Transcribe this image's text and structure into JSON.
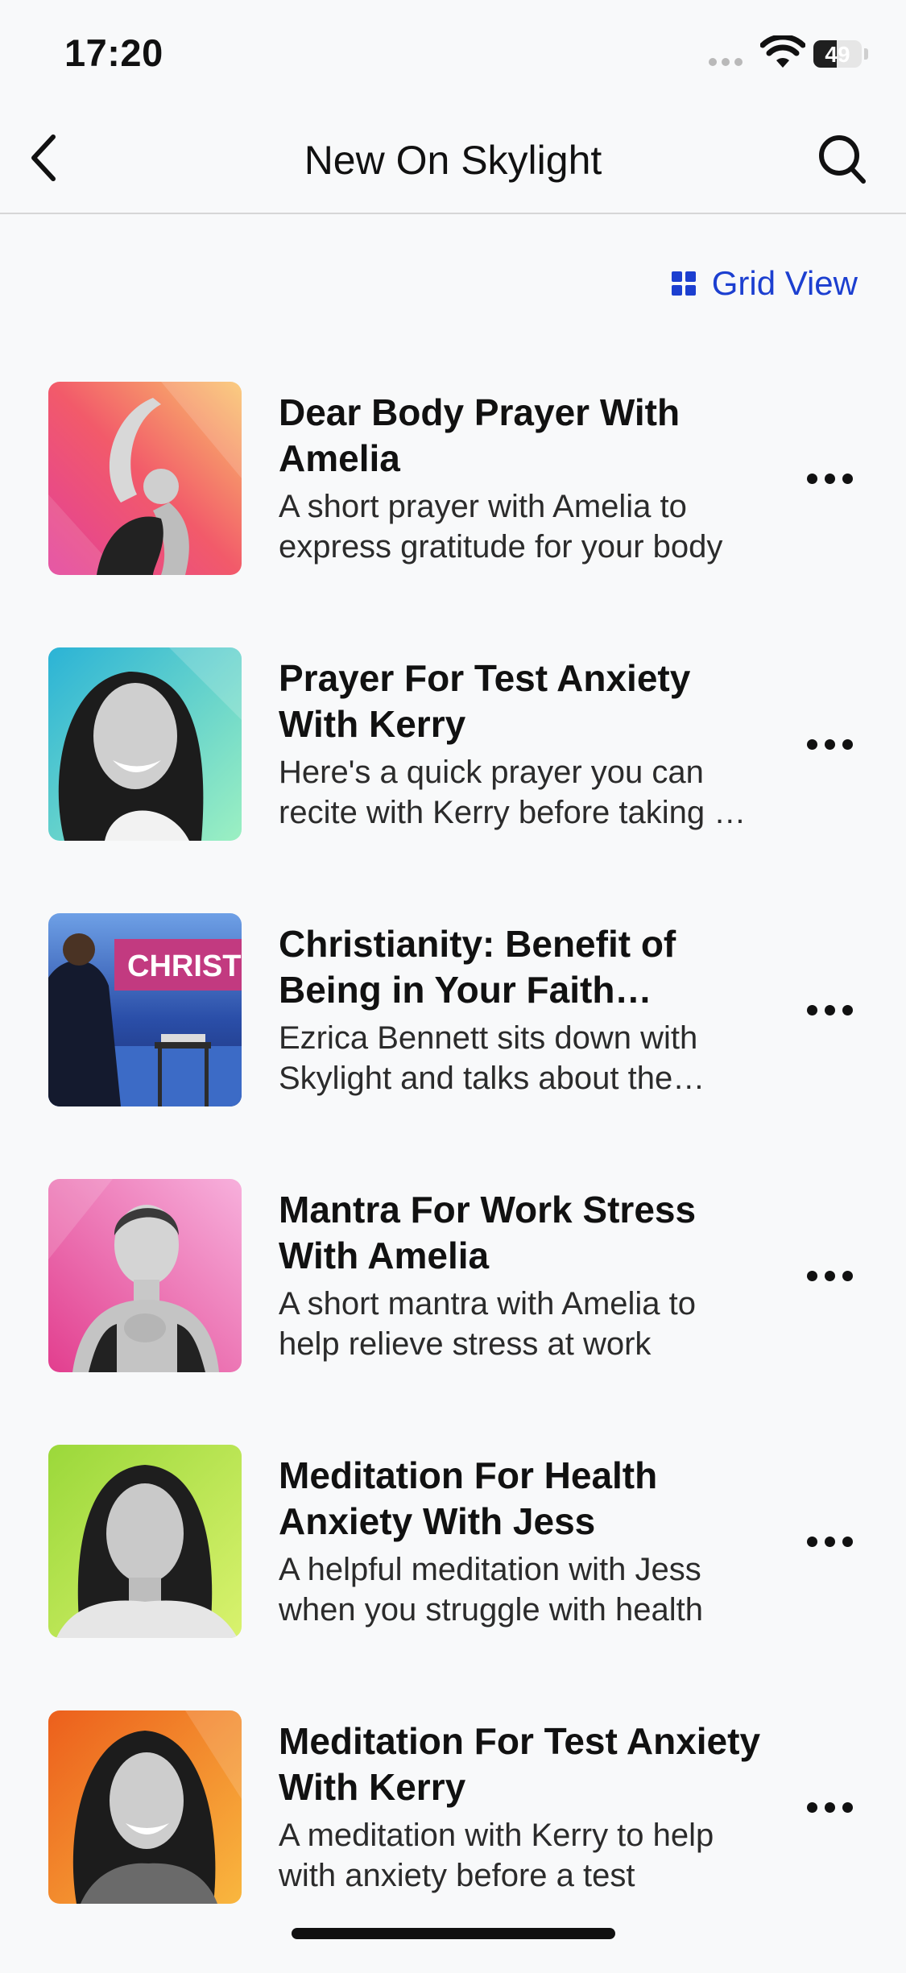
{
  "status_bar": {
    "time": "17:20",
    "battery": "49",
    "battery_level": 0.49
  },
  "navbar": {
    "title": "New On Skylight",
    "back_icon": "chevron-left-icon",
    "search_icon": "search-icon"
  },
  "view_toggle": {
    "label": "Grid View",
    "icon": "grid-icon",
    "color": "#1c3fd0"
  },
  "items": [
    {
      "title": "Dear Body Prayer With Amelia",
      "description": "A short prayer with Amelia to express gratitude for your body",
      "thumb_colors": [
        "#f25a8a",
        "#f9b46a"
      ]
    },
    {
      "title": "Prayer For Test Anxiety With Kerry",
      "description": "Here's a quick prayer you can recite with Kerry before taking a test",
      "thumb_colors": [
        "#35c8d9",
        "#9af0c9"
      ]
    },
    {
      "title": "Christianity: Benefit of Being in Your Faith Community",
      "description": "Ezrica Bennett sits down with Skylight and talks about the benefits",
      "thumb_badge": "CHRIST",
      "thumb_colors": [
        "#1b2d6e",
        "#6ea0e6"
      ]
    },
    {
      "title": "Mantra For Work Stress With Amelia",
      "description": "A short mantra with Amelia to help relieve stress at work",
      "thumb_colors": [
        "#e5469c",
        "#f5a0d0"
      ]
    },
    {
      "title": "Meditation For Health Anxiety With Jess",
      "description": "A helpful meditation with Jess when you struggle with health",
      "thumb_colors": [
        "#a6dc3c",
        "#d7f06a"
      ]
    },
    {
      "title": "Meditation For Test Anxiety With Kerry",
      "description": "A meditation with Kerry to help with anxiety before a test",
      "thumb_colors": [
        "#ef6a1f",
        "#f7b13c"
      ]
    }
  ]
}
